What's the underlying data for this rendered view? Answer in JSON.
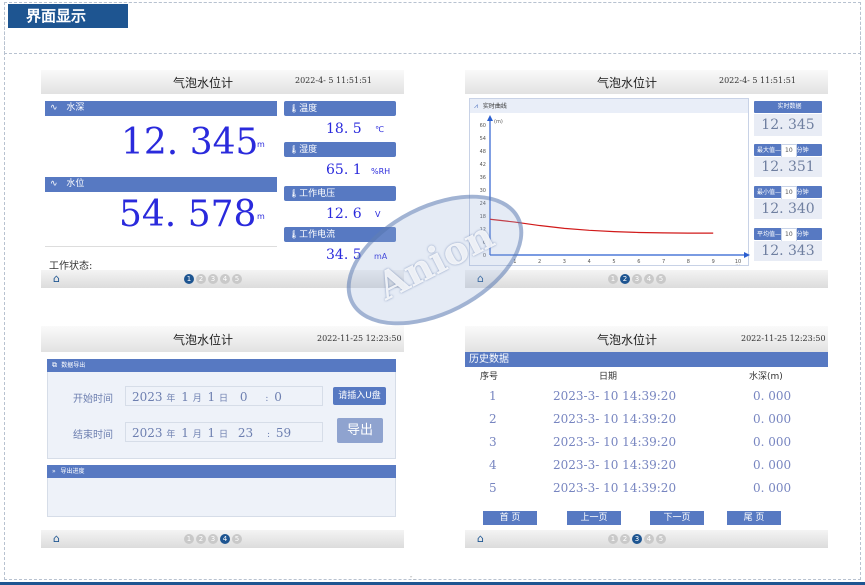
{
  "section_title": "界面显示",
  "footer_fragment": "“..",
  "watermark": "Anion",
  "app_title": "气泡水位计",
  "panel1": {
    "time": "2022-4- 5  11:51:51",
    "depth_label": "水深",
    "depth_value": "12. 345",
    "depth_unit": "m",
    "level_label": "水位",
    "level_value": "54. 578",
    "level_unit": "m",
    "temp_label": "温度",
    "temp_value": "18. 5",
    "temp_unit": "℃",
    "hum_label": "湿度",
    "hum_value": "65. 1",
    "hum_unit": "%RH",
    "volt_label": "工作电压",
    "volt_value": "12. 6",
    "volt_unit": "V",
    "curr_label": "工作电流",
    "curr_value": "34. 5",
    "curr_unit": "mA",
    "status_label": "工作状态:",
    "thermo_glyph": "🌡",
    "wave_glyph": "∿"
  },
  "panel2": {
    "time": "2022-4- 5  11:51:51",
    "chart_title": "实时曲线",
    "rt_label": "实时数据",
    "rt_value": "12. 345",
    "max_label": "最大值—",
    "max_minutes": "10",
    "min_label": "最小值—",
    "min_minutes": "10",
    "avg_label": "平均值—",
    "avg_minutes": "10",
    "minutes_unit": "分钟",
    "max_value": "12. 351",
    "min_value": "12. 340",
    "avg_value": "12. 343"
  },
  "panel3": {
    "time": "2022-11-25  12:23:50",
    "export_title": "数据导出",
    "start_label": "开始时间",
    "end_label": "结束时间",
    "start_year": "2023",
    "start_month": "1",
    "start_day": "1",
    "start_hour": "0",
    "start_min": "0",
    "end_year": "2023",
    "end_month": "1",
    "end_day": "1",
    "end_hour": "23",
    "end_min": "59",
    "year_char": "年",
    "month_char": "月",
    "day_char": "日",
    "colon": ":",
    "usb_button": "请插入U盘",
    "export_button": "导出",
    "progress_title": "导出进度"
  },
  "panel4": {
    "time": "2022-11-25  12:23:50",
    "history_title": "历史数据",
    "headers": [
      "序号",
      "日期",
      "水深(m)"
    ],
    "rows": [
      [
        "1",
        "2023-3- 10  14:39:20",
        "0. 000"
      ],
      [
        "2",
        "2023-3- 10  14:39:20",
        "0. 000"
      ],
      [
        "3",
        "2023-3- 10  14:39:20",
        "0. 000"
      ],
      [
        "4",
        "2023-3- 10  14:39:20",
        "0. 000"
      ],
      [
        "5",
        "2023-3- 10  14:39:20",
        "0. 000"
      ]
    ],
    "btn_first": "首 页",
    "btn_prev": "上一页",
    "btn_next": "下一页",
    "btn_last": "尾 页"
  },
  "pages": [
    "1",
    "2",
    "3",
    "4",
    "5"
  ],
  "active_page": {
    "panel1": 1,
    "panel2": 2,
    "panel3": 4,
    "panel4": 3
  },
  "home_icon": "⌂",
  "chart_data": {
    "type": "line",
    "title": "实时曲线",
    "ylabel": "(m)",
    "xlabel": "",
    "ylim": [
      0,
      60
    ],
    "xlim": [
      0,
      10
    ],
    "y_ticks": [
      "60",
      "54",
      "48",
      "42",
      "36",
      "30",
      "24",
      "18",
      "12",
      "6",
      "0"
    ],
    "x_ticks": [
      "1",
      "2",
      "3",
      "4",
      "5",
      "6",
      "7",
      "8",
      "9",
      "10"
    ],
    "x_unit": "(h)",
    "x": [
      0,
      1,
      2,
      3,
      4,
      5,
      6,
      7,
      8,
      9
    ],
    "series": [
      {
        "values": [
          16.5,
          15.2,
          13.6,
          12.3,
          11.4,
          10.8,
          10.4,
          10.2,
          10.1,
          10.1
        ]
      }
    ],
    "line_color": "#d11a1a",
    "grid": false
  }
}
